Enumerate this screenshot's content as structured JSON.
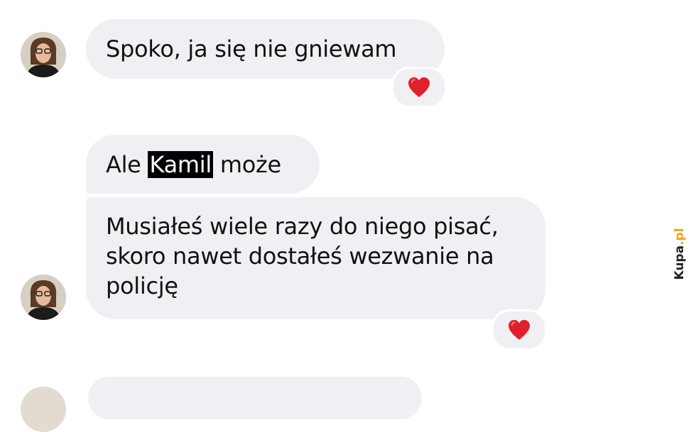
{
  "messages": [
    {
      "text": "Spoko, ja się nie gniewam",
      "reaction": "heart-emoji"
    },
    {
      "text_before": "Ale ",
      "highlighted": "Kamil",
      "text_after": " może"
    },
    {
      "lines": [
        "Musiałeś wiele razy do niego pisać,",
        "skoro nawet dostałeś wezwanie na",
        "policję"
      ],
      "reaction": "heart-emoji"
    }
  ],
  "watermark": {
    "brand": "Kupa",
    "tld": ".pl"
  },
  "colors": {
    "bubble": "#f0f0f4",
    "heart": "#e0202a",
    "highlight": "#000000",
    "watermark_accent": "#f2a21c"
  }
}
